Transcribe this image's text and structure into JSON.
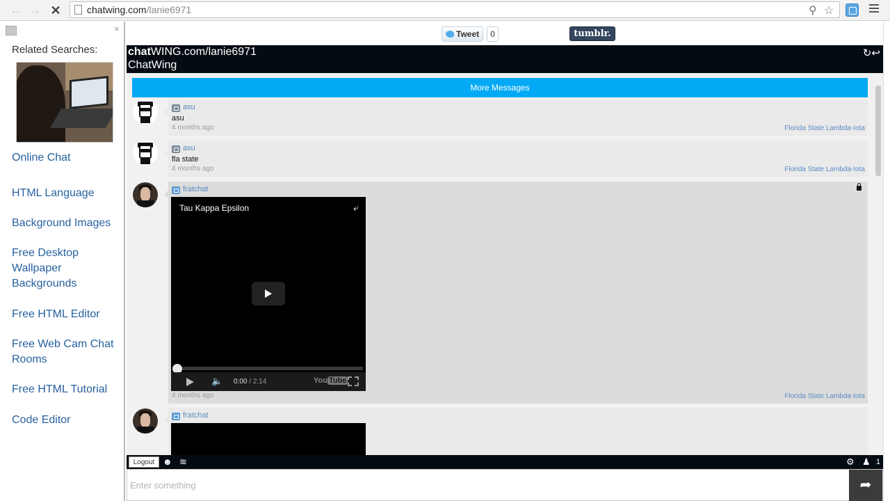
{
  "browser": {
    "url_domain": "chatwing.com",
    "url_path": "/lanie6971",
    "icons": [
      "back-arrow-icon",
      "forward-arrow-icon",
      "stop-icon",
      "search-icon",
      "star-icon",
      "extension-icon",
      "menu-icon"
    ]
  },
  "sidebar": {
    "heading": "Related Searches:",
    "links": [
      "Online Chat",
      "HTML Language",
      "Background Images",
      "Free Desktop Wallpaper Backgrounds",
      "Free HTML Editor",
      "Free Web Cam Chat Rooms",
      "Free HTML Tutorial",
      "Code Editor"
    ]
  },
  "share": {
    "tweet_label": "Tweet",
    "tweet_count": "0",
    "tumblr_label": "tumblr."
  },
  "chat": {
    "title_bold": "chat",
    "title_rest": "WING.com/lanie6971",
    "subtitle": "ChatWing",
    "more_messages": "More Messages",
    "messages": [
      {
        "user": "asu",
        "text": "asu",
        "time": "4 months ago",
        "room": "Florida State Lambda-Iota"
      },
      {
        "user": "asu",
        "text": "fla state",
        "time": "4 months ago",
        "room": "Florida State Lambda-Iota"
      },
      {
        "user": "fratchat",
        "video_title": "Tau Kappa Epsilon",
        "video_current": "0:00",
        "video_duration": "/ 2:14",
        "youtube_label": "You",
        "youtube_badge": "Tube",
        "time": "4 months ago",
        "room": "Florida State Lambda-Iota"
      },
      {
        "user": "fratchat"
      }
    ],
    "logout_label": "Logout",
    "input_placeholder": "Enter something",
    "online_count": "1"
  }
}
